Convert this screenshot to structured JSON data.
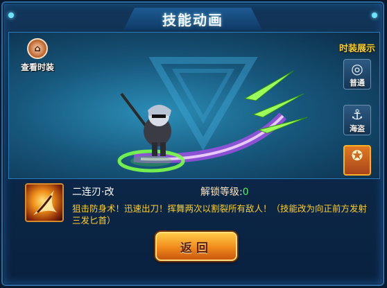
{
  "dialog": {
    "title": "技能动画"
  },
  "stage": {
    "view_fashion_label": "查看时装",
    "side_title": "时装展示",
    "fashion_buttons": [
      {
        "label": "普通",
        "icon": "swirl-icon"
      },
      {
        "label": "海盗",
        "icon": "anchor-icon"
      },
      {
        "label": "",
        "icon": "emblem-icon"
      }
    ]
  },
  "skill": {
    "name": "二连刃·改",
    "unlock_label": "解锁等级:",
    "unlock_level": "0",
    "description": "狙击防身术！迅速出刀！挥舞两次以割裂所有敌人！（技能改为向正前方发射三发匕首）"
  },
  "back_button_label": "返回",
  "colors": {
    "accent_gold": "#ffcf2b",
    "unlock_green": "#5cf05c",
    "frame_blue": "#2a6fa6"
  }
}
